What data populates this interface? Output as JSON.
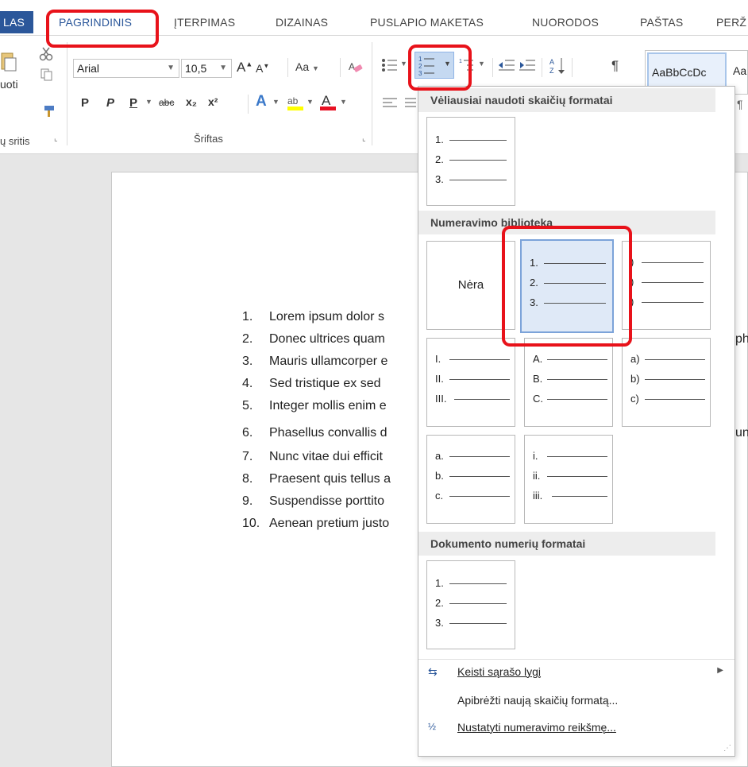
{
  "tabs": [
    {
      "label": "LAS"
    },
    {
      "label": "PAGRINDINIS"
    },
    {
      "label": "ĮTERPIMAS"
    },
    {
      "label": "DIZAINAS"
    },
    {
      "label": "PUSLAPIO MAKETAS"
    },
    {
      "label": "NUORODOS"
    },
    {
      "label": "PAŠTAS"
    },
    {
      "label": "PERŽ"
    }
  ],
  "ribbon": {
    "clipboard_paste_label": "uoti",
    "clipboard_group_label": "ų sritis",
    "font_name": "Arial",
    "font_size": "10,5",
    "font_group_label": "Šriftas",
    "case_label": "Aa",
    "bold": "P",
    "italic": "P",
    "underline": "P",
    "strike": "abc",
    "subscript": "x₂",
    "superscript": "x²",
    "style_preview": "AaBbCcDc",
    "style_preview_2": "Aa"
  },
  "document": {
    "items": [
      {
        "num": "1.",
        "text": "Lorem ipsum dolor s"
      },
      {
        "num": "2.",
        "text": "Donec ultrices quam"
      },
      {
        "num": "3.",
        "text": "Mauris ullamcorper e"
      },
      {
        "num": "4.",
        "text": "Sed tristique ex sed"
      },
      {
        "num": "5.",
        "text": "Integer mollis enim e"
      },
      {
        "num": "6.",
        "text": "Phasellus convallis d"
      },
      {
        "num": "7.",
        "text": "Nunc vitae dui efficit"
      },
      {
        "num": "8.",
        "text": "Praesent quis tellus a"
      },
      {
        "num": "9.",
        "text": "Suspendisse porttito"
      },
      {
        "num": "10.",
        "text": "Aenean pretium justo"
      }
    ],
    "overflow_right_1": "ph",
    "overflow_right_2": "un"
  },
  "dropdown": {
    "recent_header": "Vėliausiai naudoti skaičių formatai",
    "library_header": "Numeravimo biblioteka",
    "document_header": "Dokumento numerių formatai",
    "none_label": "Nėra",
    "recent_tile": [
      "1.",
      "2.",
      "3."
    ],
    "library_tiles": [
      [
        "1.",
        "2.",
        "3."
      ],
      [
        ")",
        ")",
        ")"
      ],
      [
        "I.",
        "II.",
        "III."
      ],
      [
        "A.",
        "B.",
        "C."
      ],
      [
        "a)",
        "b)",
        "c)"
      ],
      [
        "a.",
        "b.",
        "c."
      ],
      [
        "i.",
        "ii.",
        "iii."
      ]
    ],
    "document_tile": [
      "1.",
      "2.",
      "3."
    ],
    "commands": [
      {
        "label": "Keisti sąrašo lygį"
      },
      {
        "label": "Apibrėžti naują skaičių formatą..."
      },
      {
        "label": "Nustatyti numeravimo reikšmę..."
      }
    ]
  },
  "colors": {
    "accent": "#2b579a",
    "highlight_red": "#e8121a",
    "font_color_red": "#e81123",
    "highlight_yellow": "#ffff00"
  }
}
